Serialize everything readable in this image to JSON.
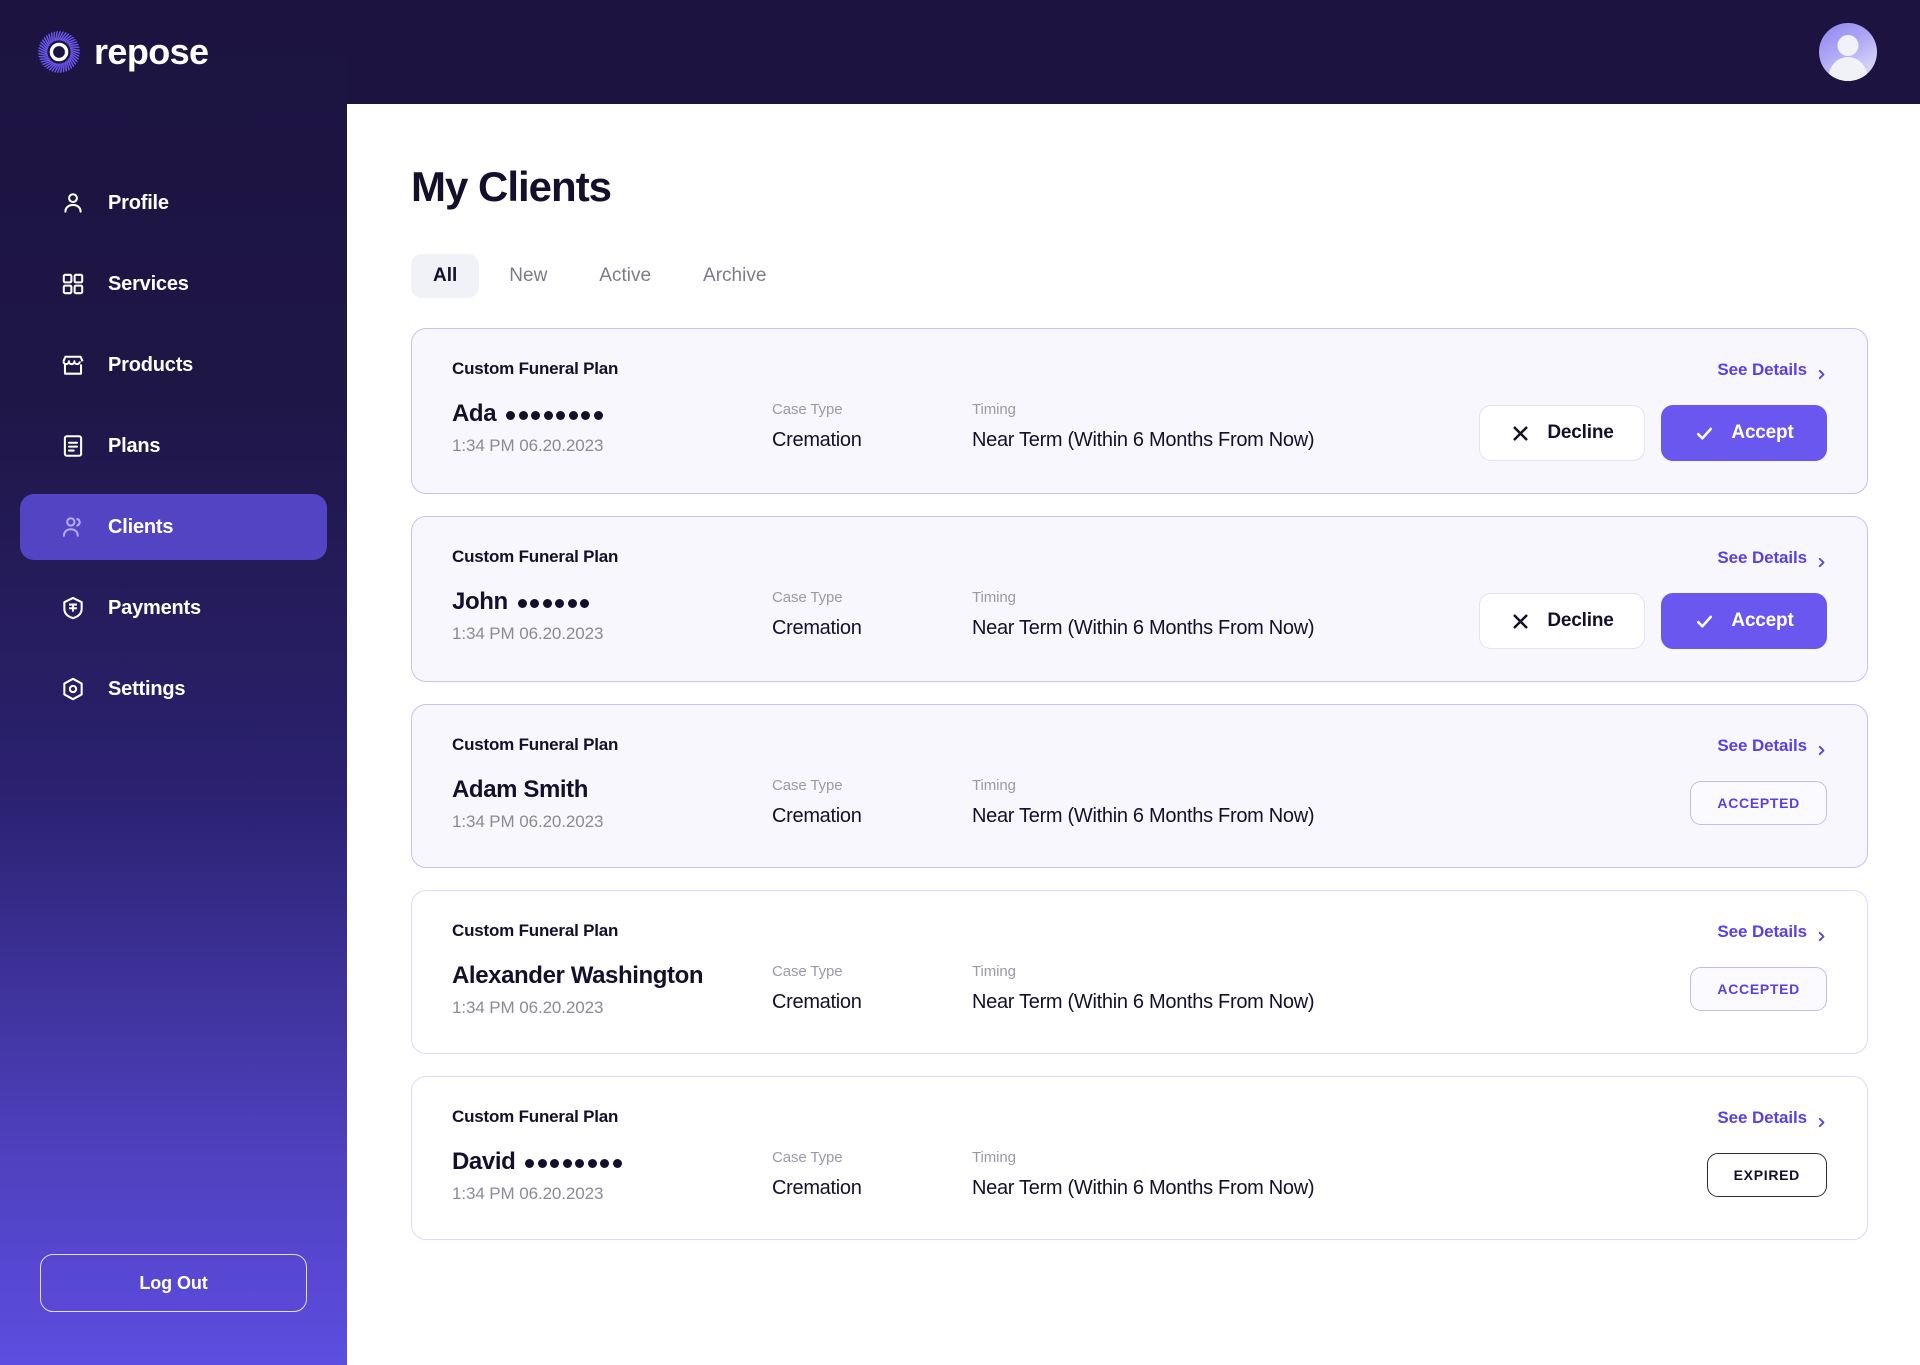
{
  "brand": {
    "name": "repose",
    "logo_icon": "repose-sunburst-logo"
  },
  "topbar": {
    "avatar_icon": "user-avatar"
  },
  "sidebar": {
    "items": [
      {
        "label": "Profile",
        "icon": "user-icon",
        "active": false
      },
      {
        "label": "Services",
        "icon": "grid-icon",
        "active": false
      },
      {
        "label": "Products",
        "icon": "storefront-icon",
        "active": false
      },
      {
        "label": "Plans",
        "icon": "document-icon",
        "active": false
      },
      {
        "label": "Clients",
        "icon": "users-icon",
        "active": true
      },
      {
        "label": "Payments",
        "icon": "card-shield-icon",
        "active": false
      },
      {
        "label": "Settings",
        "icon": "gear-hex-icon",
        "active": false
      }
    ],
    "logout_label": "Log Out"
  },
  "main": {
    "page_title": "My Clients",
    "tabs": [
      {
        "label": "All",
        "active": true
      },
      {
        "label": "New",
        "active": false
      },
      {
        "label": "Active",
        "active": false
      },
      {
        "label": "Archive",
        "active": false
      }
    ],
    "see_details_label": "See Details",
    "labels": {
      "case_type": "Case Type",
      "timing": "Timing"
    },
    "buttons": {
      "decline": "Decline",
      "accept": "Accept"
    },
    "cards": [
      {
        "plan": "Custom Funeral Plan",
        "name": "Ada",
        "masked_count": 8,
        "date": "1:34 PM 06.20.2023",
        "case_type": "Cremation",
        "timing": "Near Term (Within 6 Months From Now)",
        "state": "pending",
        "tinted": true
      },
      {
        "plan": "Custom Funeral Plan",
        "name": "John",
        "masked_count": 6,
        "date": "1:34 PM 06.20.2023",
        "case_type": "Cremation",
        "timing": "Near Term (Within 6 Months From Now)",
        "state": "pending",
        "tinted": true
      },
      {
        "plan": "Custom Funeral Plan",
        "name": "Adam Smith",
        "masked_count": 0,
        "date": "1:34 PM 06.20.2023",
        "case_type": "Cremation",
        "timing": "Near Term (Within 6 Months From Now)",
        "state": "accepted",
        "badge": "ACCEPTED",
        "tinted": true
      },
      {
        "plan": "Custom Funeral Plan",
        "name": "Alexander Washington",
        "masked_count": 0,
        "date": "1:34 PM 06.20.2023",
        "case_type": "Cremation",
        "timing": "Near Term (Within 6 Months From Now)",
        "state": "accepted",
        "badge": "ACCEPTED",
        "tinted": false
      },
      {
        "plan": "Custom Funeral Plan",
        "name": "David",
        "masked_count": 8,
        "date": "1:34 PM 06.20.2023",
        "case_type": "Cremation",
        "timing": "Near Term (Within 6 Months From Now)",
        "state": "expired",
        "badge": "EXPIRED",
        "tinted": false
      }
    ]
  },
  "colors": {
    "sidebar_top": "#1c1340",
    "sidebar_bottom": "#5c4ee0",
    "accent": "#6a57ef",
    "link": "#5b3fe0",
    "active_nav": "#5344c4",
    "card_tint": "#f8f7fd",
    "card_border": "#c9bffa",
    "text": "#14102b",
    "muted": "#8b8a98"
  }
}
